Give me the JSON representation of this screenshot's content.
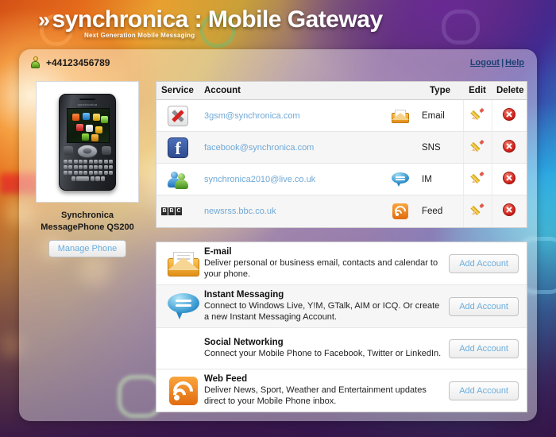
{
  "header": {
    "chevron": "»",
    "title": "synchronica : Mobile Gateway",
    "tagline": "Next Generation Mobile Messaging"
  },
  "userbar": {
    "user_icon": "person-icon",
    "phone_number": "+44123456789",
    "logout_label": "Logout",
    "separator": "|",
    "help_label": "Help"
  },
  "device": {
    "image_alt": "mobile-phone-photo",
    "name_line1": "Synchronica",
    "name_line2": "MessagePhone QS200",
    "manage_button": "Manage Phone"
  },
  "accounts": {
    "columns": {
      "service": "Service",
      "account": "Account",
      "type_icon": "",
      "type": "Type",
      "edit": "Edit",
      "delete": "Delete"
    },
    "rows": [
      {
        "service_icon": "exchange-icon",
        "account": "3gsm@synchronica.com",
        "type_icon": "email-icon",
        "type": "Email",
        "edit_icon": "pencil-icon",
        "delete_icon": "delete-icon"
      },
      {
        "service_icon": "facebook-icon",
        "account": "facebook@synchronica.com",
        "type_icon": "sns-icon",
        "type": "SNS",
        "edit_icon": "pencil-icon",
        "delete_icon": "delete-icon"
      },
      {
        "service_icon": "messenger-icon",
        "account": "synchronica2010@live.co.uk",
        "type_icon": "im-icon",
        "type": "IM",
        "edit_icon": "pencil-icon",
        "delete_icon": "delete-icon"
      },
      {
        "service_icon": "bbc-icon",
        "account": "newsrss.bbc.co.uk",
        "type_icon": "rss-icon",
        "type": "Feed",
        "edit_icon": "pencil-icon",
        "delete_icon": "delete-icon"
      }
    ]
  },
  "add_services": [
    {
      "icon": "email-icon",
      "title": "E-mail",
      "description": "Deliver personal or business email, contacts and calendar to your phone.",
      "button": "Add Account"
    },
    {
      "icon": "im-icon",
      "title": "Instant Messaging",
      "description": "Connect to Windows Live, Y!M, GTalk, AIM or ICQ. Or create a new Instant Messaging Account.",
      "button": "Add Account"
    },
    {
      "icon": "sns-icon",
      "title": "Social Networking",
      "description": "Connect your Mobile Phone to Facebook, Twitter or LinkedIn.",
      "button": "Add Account"
    },
    {
      "icon": "rss-icon",
      "title": "Web Feed",
      "description": "Deliver News, Sport, Weather and Entertainment updates direct to your Mobile Phone inbox.",
      "button": "Add Account"
    }
  ],
  "colors": {
    "link_blue": "#6fa8d6",
    "nav_link": "#1b3f73",
    "accent_orange": "#e08f16",
    "delete_red": "#cc1d17"
  },
  "bbc_letters": [
    "B",
    "B",
    "C"
  ]
}
